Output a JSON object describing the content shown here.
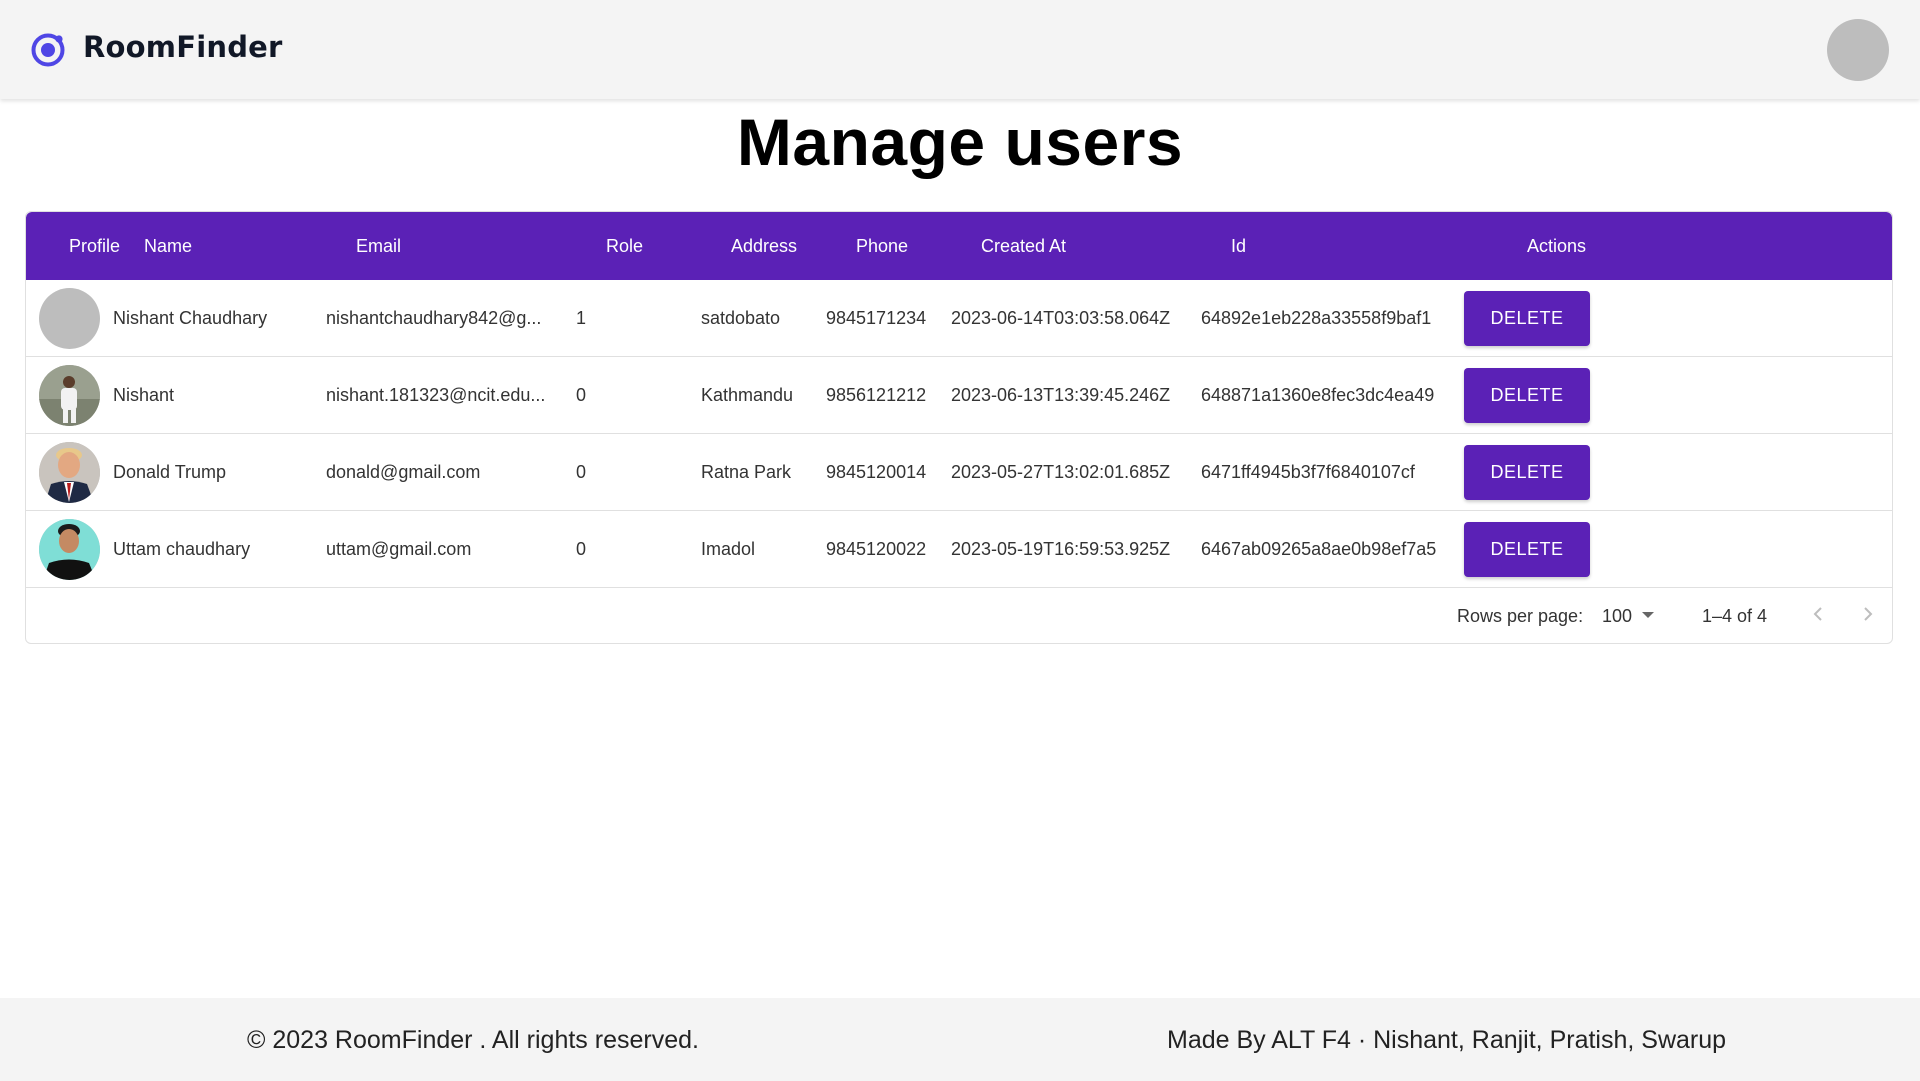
{
  "header": {
    "brand": "RoomFinder",
    "logo_icon": "ionic-logo-icon",
    "brand_color": "#5b21b6"
  },
  "page": {
    "title": "Manage users"
  },
  "table": {
    "columns": [
      "Profile",
      "Name",
      "Email",
      "Role",
      "Address",
      "Phone",
      "Created At",
      "Id",
      "Actions"
    ],
    "header_color": "#5b21b6",
    "rows": [
      {
        "name": "Nishant Chaudhary",
        "email": "nishantchaudhary842@g...",
        "role": "1",
        "address": "satdobato",
        "phone": "9845171234",
        "created_at": "2023-06-14T03:03:58.064Z",
        "id": "64892e1eb228a33558f9baf1",
        "action": "DELETE"
      },
      {
        "name": "Nishant",
        "email": "nishant.181323@ncit.edu...",
        "role": "0",
        "address": "Kathmandu",
        "phone": "9856121212",
        "created_at": "2023-06-13T13:39:45.246Z",
        "id": "648871a1360e8fec3dc4ea49",
        "action": "DELETE"
      },
      {
        "name": "Donald Trump",
        "email": "donald@gmail.com",
        "role": "0",
        "address": "Ratna Park",
        "phone": "9845120014",
        "created_at": "2023-05-27T13:02:01.685Z",
        "id": "6471ff4945b3f7f6840107cf",
        "action": "DELETE"
      },
      {
        "name": "Uttam chaudhary",
        "email": "uttam@gmail.com",
        "role": "0",
        "address": "Imadol",
        "phone": "9845120022",
        "created_at": "2023-05-19T16:59:53.925Z",
        "id": "6467ab09265a8ae0b98ef7a5",
        "action": "DELETE"
      }
    ]
  },
  "pagination": {
    "rows_per_page_label": "Rows per page:",
    "rows_per_page_value": "100",
    "range": "1–4 of 4"
  },
  "footer": {
    "copyright": "© 2023 RoomFinder . All rights reserved.",
    "made_by": "Made By ALT F4 · Nishant, Ranjit, Pratish, Swarup"
  }
}
